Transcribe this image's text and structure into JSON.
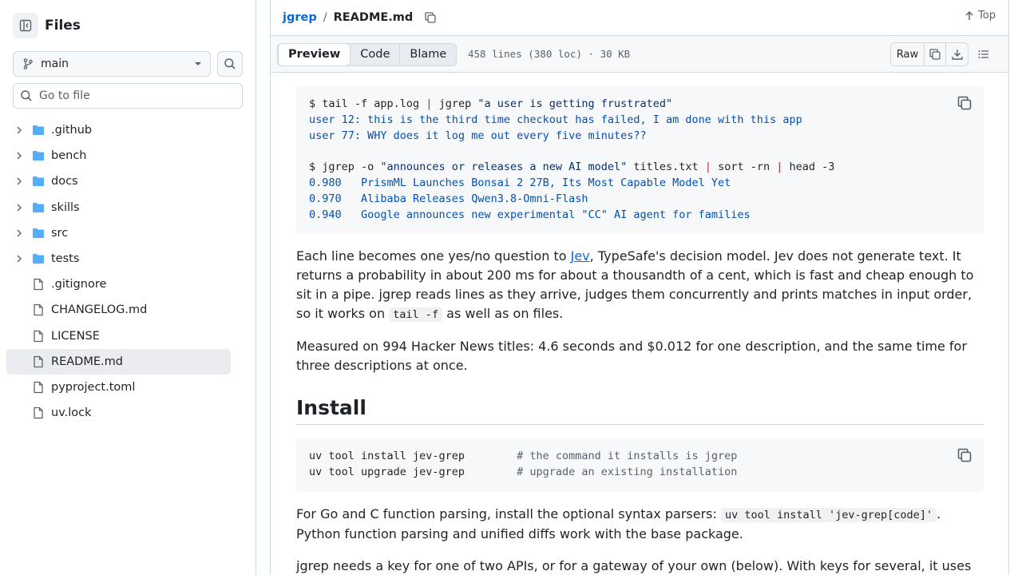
{
  "sidebar": {
    "title": "Files",
    "branch": "main",
    "goto_placeholder": "Go to file",
    "items": [
      {
        "name": ".github",
        "type": "folder"
      },
      {
        "name": "bench",
        "type": "folder"
      },
      {
        "name": "docs",
        "type": "folder"
      },
      {
        "name": "skills",
        "type": "folder"
      },
      {
        "name": "src",
        "type": "folder"
      },
      {
        "name": "tests",
        "type": "folder"
      },
      {
        "name": ".gitignore",
        "type": "file"
      },
      {
        "name": "CHANGELOG.md",
        "type": "file"
      },
      {
        "name": "LICENSE",
        "type": "file"
      },
      {
        "name": "README.md",
        "type": "file",
        "selected": true
      },
      {
        "name": "pyproject.toml",
        "type": "file"
      },
      {
        "name": "uv.lock",
        "type": "file"
      }
    ]
  },
  "header": {
    "repo": "jgrep",
    "separator": "/",
    "file": "README.md",
    "top_label": "Top"
  },
  "toolbar": {
    "tabs": [
      "Preview",
      "Code",
      "Blame"
    ],
    "active_tab": "Preview",
    "meta": "458 lines (380 loc) · 30 KB",
    "raw_label": "Raw"
  },
  "readme": {
    "code1": {
      "line1_prompt": "$ tail -f app.log ",
      "line1_pipe": "|",
      "line1_cmd": " jgrep ",
      "line1_str": "\"a user is getting frustrated\"",
      "out1": "user 12: this is the third time checkout has failed, I am done with this app",
      "out2": "user 77: WHY does it log me out every five minutes??",
      "line2_prompt": "$ jgrep -o ",
      "line2_str": "\"announces or releases a new AI model\"",
      "line2_mid": " titles.txt ",
      "line2_pipe1": "|",
      "line2_sort": " sort -rn ",
      "line2_pipe2": "|",
      "line2_head": " head -3",
      "res1": "0.980   PrismML Launches Bonsai 2 27B, Its Most Capable Model Yet",
      "res2": "0.970   Alibaba Releases Qwen3.8-Omni-Flash",
      "res3": "0.940   Google announces new experimental \"CC\" AI agent for families"
    },
    "para1_a": "Each line becomes one yes/no question to ",
    "para1_link": "Jev",
    "para1_b": ", TypeSafe's decision model. Jev does not generate text. It returns a probability in about 200 ms for about a thousandth of a cent, which is fast and cheap enough to sit in a pipe. jgrep reads lines as they arrive, judges them concurrently and prints matches in input order, so it works on ",
    "para1_code": "tail -f",
    "para1_c": " as well as on files.",
    "para2": "Measured on 994 Hacker News titles: 4.6 seconds and $0.012 for one description, and the same time for three descriptions at once.",
    "install_heading": "Install",
    "code2": {
      "l1_cmd": "uv tool install jev-grep        ",
      "l1_comment": "# the command it installs is jgrep",
      "l2_cmd": "uv tool upgrade jev-grep        ",
      "l2_comment": "# upgrade an existing installation"
    },
    "para3_a": "For Go and C function parsing, install the optional syntax parsers: ",
    "para3_code": "uv tool install 'jev-grep[code]'",
    "para3_b": ". Python function parsing and unified diffs work with the base package.",
    "para4": "jgrep needs a key for one of two APIs, or for a gateway of your own (below). With keys for several, it uses"
  },
  "icons": {
    "sidebar_toggle": "sidebar-collapse-icon",
    "branch": "git-branch-icon",
    "search": "search-icon",
    "folder": "folder-icon",
    "file": "file-icon",
    "copy": "copy-icon",
    "download": "download-icon",
    "outline": "list-unordered-icon",
    "top": "arrow-up-icon"
  },
  "colors": {
    "accent": "#0969da",
    "folder": "#54aeff",
    "border": "#d1d9e0"
  }
}
